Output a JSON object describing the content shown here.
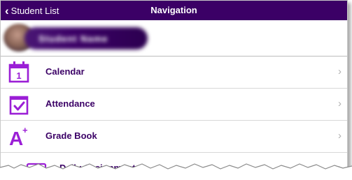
{
  "colors": {
    "accent": "#3b0066",
    "icon": "#9b1fd6",
    "navbar": "#3b0066"
  },
  "navbar": {
    "back_label": "Student List",
    "title": "Navigation",
    "back_icon": "chevron-left-icon"
  },
  "profile": {
    "name": "Student Name",
    "avatar_icon": "avatar"
  },
  "menu": {
    "items": [
      {
        "label": "Calendar",
        "icon": "calendar-icon",
        "calendar_number": "1"
      },
      {
        "label": "Attendance",
        "icon": "attendance-check-icon"
      },
      {
        "label": "Grade Book",
        "icon": "grade-a-plus-icon",
        "glyph": "A",
        "superscript": "+"
      },
      {
        "label": "Daily Assignments",
        "icon": "assignment-list-icon"
      }
    ]
  }
}
